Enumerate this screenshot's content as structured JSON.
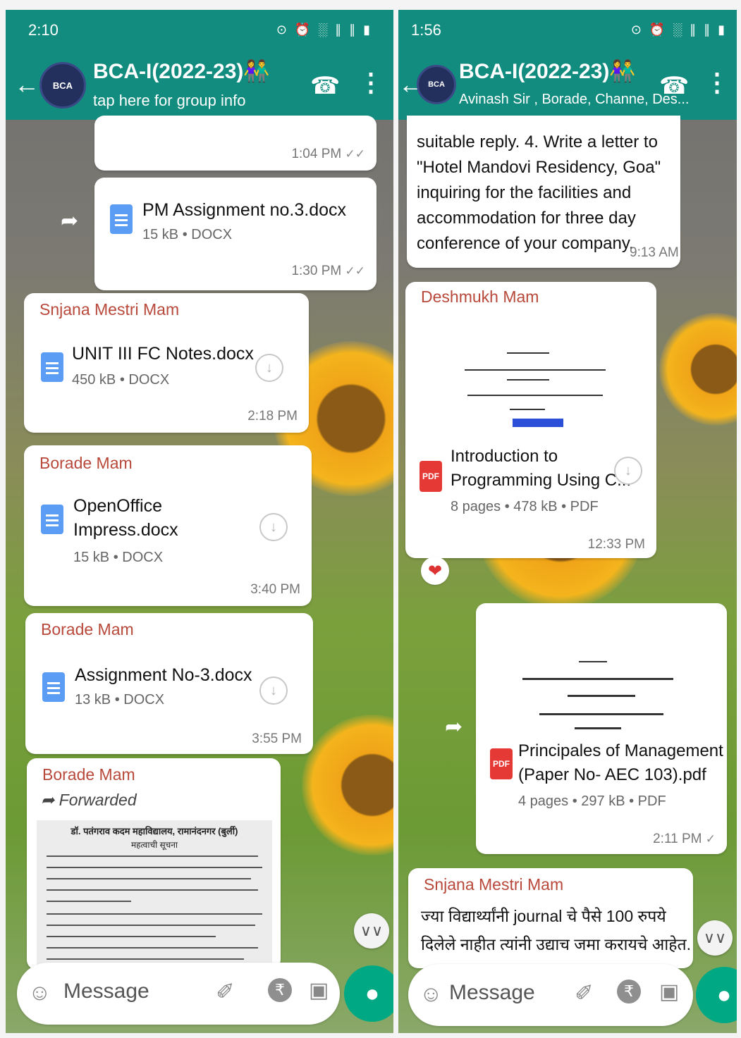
{
  "left": {
    "status_time": "2:10",
    "status_icons": "⊙ ⏰ ░ ∥ ∥ ▮",
    "group_title": "BCA-I(2022-23)👫",
    "group_subtitle": "tap here for group info",
    "avatar_text": "BCA",
    "messages": [
      {
        "time": "1:04 PM",
        "ticks": "✓✓"
      },
      {
        "file_name": "PM Assignment no.3.docx",
        "meta": "15 kB • DOCX",
        "time": "1:30 PM",
        "ticks": "✓✓"
      },
      {
        "sender": "Snjana Mestri Mam",
        "file_name": "UNIT III FC Notes.docx",
        "meta": "450 kB • DOCX",
        "time": "2:18 PM"
      },
      {
        "sender": "Borade Mam",
        "file_name_line1": "OpenOffice",
        "file_name_line2": "Impress.docx",
        "meta": "15 kB • DOCX",
        "time": "3:40 PM"
      },
      {
        "sender": "Borade Mam",
        "file_name": "Assignment No-3.docx",
        "meta": "13 kB • DOCX",
        "time": "3:55 PM"
      },
      {
        "sender": "Borade Mam",
        "forwarded": "Forwarded",
        "preview_title": "डॉ. पतंगराव कदम महाविद्यालय, रामानंदनगर (बुर्ली)",
        "preview_subtitle": "महत्वाची सूचना"
      }
    ],
    "input_placeholder": "Message"
  },
  "right": {
    "status_time": "1:56",
    "status_icons": "⊙ ⏰ ░ ∥ ∥ ▮",
    "group_title": "BCA-I(2022-23)👫",
    "group_subtitle": "Avinash Sir , Borade, Channe, Des...",
    "avatar_text": "BCA",
    "messages": [
      {
        "text_lines": [
          "suitable reply. 4.  Write a letter to",
          "\"Hotel Mandovi Residency, Goa\"",
          "inquiring for the facilities and",
          "accommodation for three day",
          "conference of your company."
        ],
        "time": "9:13 AM"
      },
      {
        "sender": "Deshmukh Mam",
        "file_name_line1": "Introduction to",
        "file_name_line2": "Programming Using C...",
        "meta": "8 pages • 478 kB • PDF",
        "time": "12:33 PM",
        "reaction": "❤"
      },
      {
        "file_name_line1": "Principales of Management",
        "file_name_line2": "(Paper No- AEC 103).pdf",
        "meta": "4 pages • 297 kB • PDF",
        "time": "2:11 PM",
        "ticks": "✓"
      },
      {
        "sender": "Snjana Mestri Mam",
        "text_lines": [
          "ज्या विद्यार्थ्यांनी journal चे पैसे 100 रुपये",
          "दिलेले नाहीत त्यांनी उद्याच जमा करायचे आहेत."
        ]
      }
    ],
    "input_placeholder": "Message"
  },
  "icons": {
    "back": "←",
    "call": "☎",
    "menu": "⋮",
    "forward": "➦",
    "download": "↓",
    "emoji": "☺",
    "attach": "✐",
    "rupee": "₹",
    "camera": "▣",
    "mic": "●",
    "scroll_down": "∨∨",
    "pdf": "PDF"
  },
  "colors": {
    "header": "#128c7e",
    "sender": "#b8483a",
    "mic": "#00a884",
    "pdf": "#e53935",
    "doc": "#5b9cf4"
  }
}
